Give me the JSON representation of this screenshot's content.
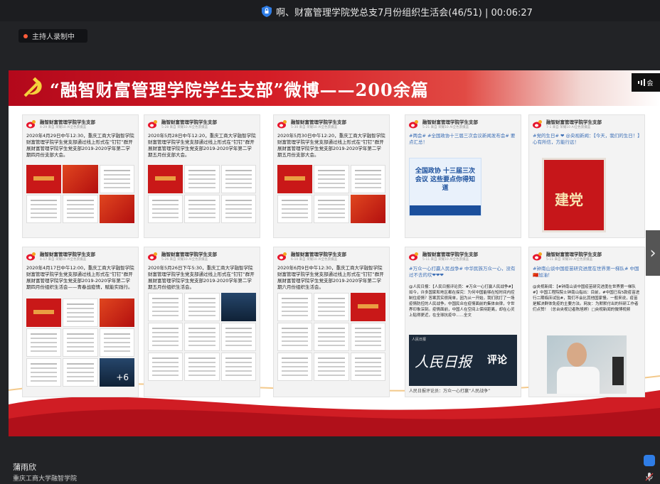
{
  "window": {
    "meeting_title": "啊、财富管理学院党总支7月份组织生活会(46/51) | 00:06:27"
  },
  "recording": {
    "label": "主持人录制中"
  },
  "slide": {
    "banner_title": "“融智财富管理学院学生支部”微博——200余篇",
    "corner_text": "会"
  },
  "cards": [
    {
      "account": "融智财富管理学院学生支部",
      "meta": "4-29  来自 荣耀10 AI全色景摄蓝",
      "text": "2020年4月29日中午12:30，重庆工商大学融智学院财富管理学院学生党支部通过线上形式在“钉钉”群开展财富管理学院学生党支部2019-2020学年第二学期四月份支部大会。"
    },
    {
      "account": "融智财富管理学院学生支部",
      "meta": "5-28  来自 荣耀10 AI全色景摄蓝",
      "text": "2020年5月28日中午12:20，重庆工商大学融智学院财富管理学院学生党支部通过线上形式在“钉钉”群开展财富管理学院学生党支部2019-2020学年第二学期五月份支部大会。"
    },
    {
      "account": "融智财富管理学院学生支部",
      "meta": "5-30  来自 荣耀10 AI全色景摄蓝",
      "text": "2020年5月30日中午12:20，重庆工商大学融智学院财富管理学院学生党支部通过线上形式在“钉钉”群开展财富管理学院学生党支部2019-2020学年第二学期五月份支部大会。"
    },
    {
      "account": "融智财富管理学院学生支部",
      "meta": "5-21  来自 荣耀10 AI全色景摄蓝",
      "text": "#两会# #全国政协十三届三次会议新闻发布会# 要点汇总！",
      "promo": "全国政协 十三届三次会议 这些要点你得知道"
    },
    {
      "account": "融智财富管理学院学生支部",
      "meta": "7-1  来自 荣耀10 AI全色景摄蓝",
      "text": "#党的生日# ❤ @央视新闻：【今天，我们的生日！】心有所信，方能行远！",
      "book": "建党"
    },
    {
      "account": "融智财富管理学院学生支部",
      "meta": "4-17  来自 荣耀10 AI全色景摄蓝",
      "text": "2020年4月17日中午12:00，重庆工商大学融智学院财富管理学院学生党支部通过线上形式在“钉钉”群开展财富管理学院学生党支部2019-2020学年第二学期四月份组织生活会——青春战疫情，賦能实践行。",
      "more": "+6"
    },
    {
      "account": "融智财富管理学院学生支部",
      "meta": "5-26  来自 荣耀10 AI全色景摄蓝",
      "text": "2020年5月26日下午5:30，重庆工商大学融智学院财富管理学院学生党支部通过线上形式在“钉钉”群开展财富管理学院学生党支部2019-2020学年第二学期五月份组织生活会。"
    },
    {
      "account": "融智财富管理学院学生支部",
      "meta": "6-10  来自 荣耀10 AI全色景摄蓝",
      "text": "2020年6月9日中午12:30，重庆工商大学融智学院财富管理学院学生党支部通过线上形式在“钉钉”群开展财富管理学院学生党支部2019-2020学年第二学期六月份组织生活会。"
    },
    {
      "account": "融智财富管理学院学生支部",
      "meta": "5-11  来自 荣耀10 AI全色景摄蓝",
      "text": "#万众一心打赢人民战争# 中华民族万众一心，没有过不去的坎❤❤❤",
      "quote": "@人民日报：【人民日报评论员：#万众一心打赢人民战争#】如今，许多国家和地区都在探究：为何中国能够在短时间内控制住疫情？答案其实很简单，因为从一开始，我们就打了一场疫情防控的人民战争。中国民众在疫情面前的集体自律，令世界印象深刻。疫情面前，中国人在空间上保持距离，却在心灵上贴得更近，在全球抗疫中……全文",
      "news_logo": "人民日报",
      "news_right": "评论",
      "news_top": "人民日报",
      "caption": "人民日报评论员：万众一心打赢“人民战争”"
    },
    {
      "account": "融智财富管理学院学生支部",
      "meta": "5-11  来自 荣耀10 AI全色景摄蓝",
      "text": "#钟南山谈中国疫苗研究进度在世界第一梯队# 中国🇨🇳加油！",
      "quote": "@央视新闻：【#钟南山谈中国疫苗研究进度在世界第一梯队#】中国工程院院士钟南山指出：目前，#中国已有5款疫苗进行二期临床试验#，我们不会比其他国家慢。一般来说，疫苗是解决群体免疫的主要方法。网友：为默默付出的科研工作者们点赞！（总台央视记者陈旭婷）□央视新闻的微博视频"
    }
  ],
  "participant": {
    "name": "蒲雨欣",
    "org": "重庆工商大学融智学院"
  },
  "icons": {
    "security": "shield-lock-icon",
    "next": "chevron-right-icon",
    "chat": "chat-icon",
    "mic": "mic-off-icon",
    "party": "party-emblem-icon",
    "weibo": "weibo-icon"
  },
  "colors": {
    "banner_red": "#c8121c",
    "meeting_bg": "#222326",
    "accent_blue": "#2f7de6"
  }
}
